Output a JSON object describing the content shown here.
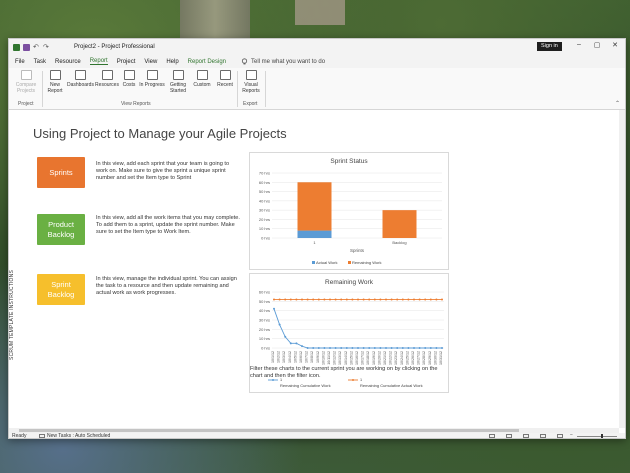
{
  "window": {
    "title": "Project2 - Project Professional",
    "sign_in": "Sign in"
  },
  "menu": {
    "tabs": [
      "File",
      "Task",
      "Resource",
      "Report",
      "Project",
      "View",
      "Help",
      "Report Design"
    ],
    "active_tab": "Report",
    "tell_me": "Tell me what you want to do"
  },
  "ribbon": {
    "project_group": {
      "label": "Project",
      "compare": "Compare Projects"
    },
    "view_reports_group": {
      "label": "View Reports",
      "buttons": [
        "New Report",
        "Dashboards",
        "Resources",
        "Costs",
        "In Progress",
        "Getting Started",
        "Custom",
        "Recent"
      ]
    },
    "export_group": {
      "label": "Export",
      "visual_reports": "Visual Reports"
    }
  },
  "sidebar_label": "SCRUM TEMPLATE INSTRUCTIONS",
  "page_title": "Using Project to Manage your Agile Projects",
  "cards": [
    {
      "button": "Sprints",
      "text": "In this view, add each sprint that your team is going to work on. Make sure to give the sprint a unique sprint number and set the Item type to Sprint",
      "color": "#e8752f"
    },
    {
      "button": "Product Backlog",
      "text": "In this view, add all the work items that you may complete. To add them to a sprint, update the sprint number. Make sure to set the Item type to Work Item.",
      "color": "#6ab043"
    },
    {
      "button": "Sprint Backlog",
      "text": "In this view, manage the individual sprint. You can assign the task to a resource and then update remaining and actual work as work progresses.",
      "color": "#f6bf2c"
    }
  ],
  "chart_data": [
    {
      "type": "bar",
      "title": "Sprint Status",
      "categories": [
        "1",
        "Backlog"
      ],
      "xlabel": "Sprints",
      "ylabel": "",
      "ylim": [
        0,
        70
      ],
      "yticks": [
        "0 hrs",
        "10 hrs",
        "20 hrs",
        "30 hrs",
        "40 hrs",
        "50 hrs",
        "60 hrs",
        "70 hrs"
      ],
      "stacked": true,
      "series": [
        {
          "name": "Actual Work",
          "values": [
            8,
            0
          ],
          "color": "#5b9bd5"
        },
        {
          "name": "Remaining Work",
          "values": [
            52,
            30
          ],
          "color": "#ed7d31"
        }
      ],
      "legend": "bottom"
    },
    {
      "type": "line",
      "title": "Remaining Work",
      "x": [
        "10/1/12",
        "10/2/12",
        "10/3/12",
        "10/4/12",
        "10/5/12",
        "10/6/12",
        "10/7/12",
        "10/8/12",
        "10/9/12",
        "10/10/12",
        "10/11/12",
        "10/12/12",
        "10/13/12",
        "10/14/12",
        "10/15/12",
        "10/16/12",
        "10/17/12",
        "10/18/12",
        "10/19/12",
        "10/20/12",
        "10/21/12",
        "10/22/12",
        "10/23/12",
        "10/24/12",
        "10/25/12",
        "10/26/12",
        "10/27/12",
        "10/28/12",
        "10/29/12",
        "10/30/12",
        "10/31/12"
      ],
      "ylim": [
        0,
        60
      ],
      "yticks": [
        "0 hrs",
        "10 hrs",
        "20 hrs",
        "30 hrs",
        "40 hrs",
        "50 hrs",
        "60 hrs"
      ],
      "series": [
        {
          "name": "Remaining Cumulative Work",
          "color": "#5b9bd5",
          "values": [
            42,
            25,
            12,
            5,
            5,
            2,
            0,
            0,
            0,
            0,
            0,
            0,
            0,
            0,
            0,
            0,
            0,
            0,
            0,
            0,
            0,
            0,
            0,
            0,
            0,
            0,
            0,
            0,
            0,
            0,
            0
          ]
        },
        {
          "name": "Remaining Cumulative Actual Work",
          "color": "#ed7d31",
          "values": [
            52,
            52,
            52,
            52,
            52,
            52,
            52,
            52,
            52,
            52,
            52,
            52,
            52,
            52,
            52,
            52,
            52,
            52,
            52,
            52,
            52,
            52,
            52,
            52,
            52,
            52,
            52,
            52,
            52,
            52,
            52
          ]
        }
      ],
      "legend_markers": [
        "1",
        "1"
      ],
      "legend": "bottom"
    }
  ],
  "filter_note": "Filter these charts to the current sprint you are working on by clicking on the chart and then the filter icon.",
  "status": {
    "ready": "Ready",
    "new_tasks": "New Tasks : Auto Scheduled"
  }
}
